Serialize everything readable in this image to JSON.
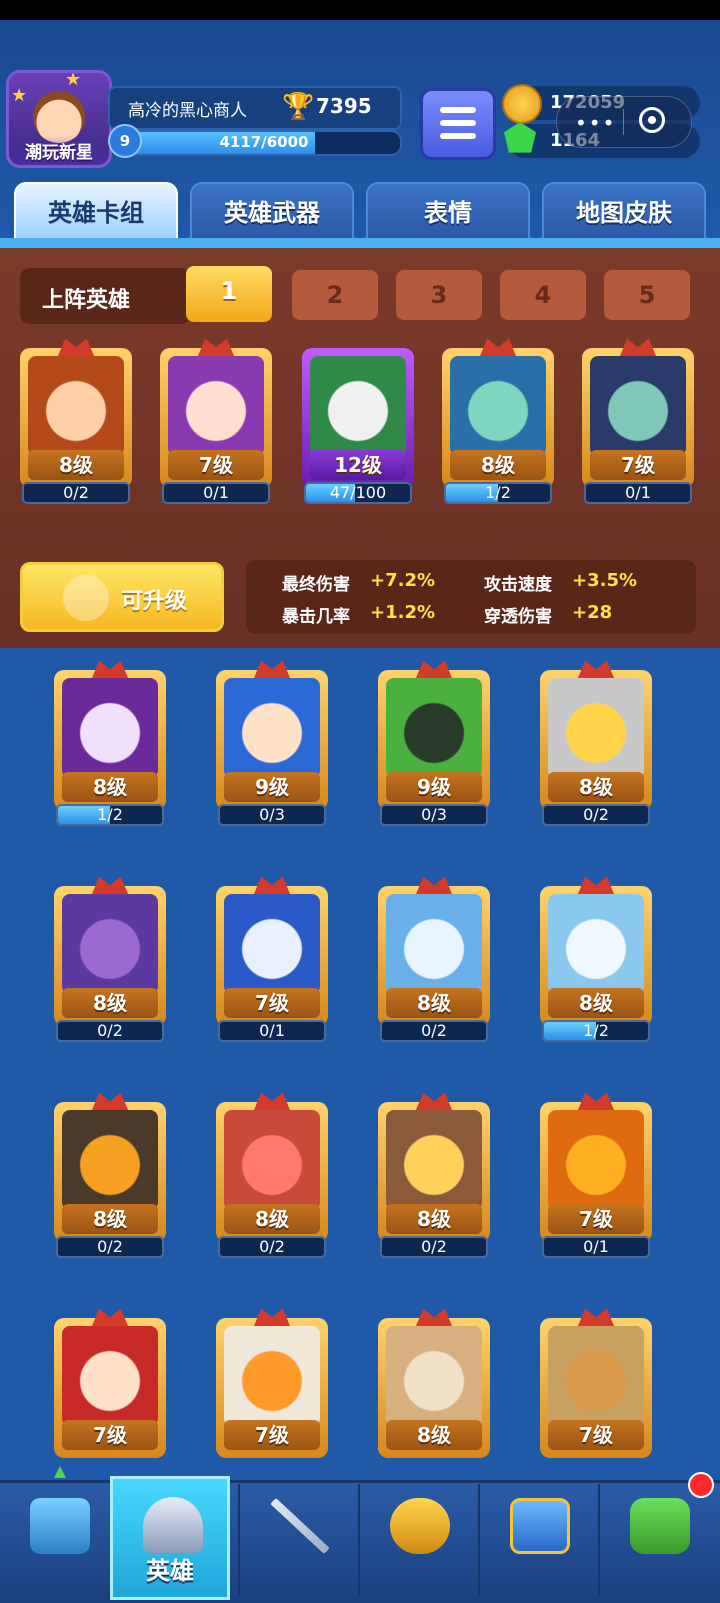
{
  "player": {
    "title": "潮玩新星",
    "name": "高冷的黑心商人",
    "trophies": "7395",
    "level": "9",
    "xp_text": "4117/6000",
    "xp_fraction": 0.686
  },
  "currency": {
    "coins": "172059",
    "gems": "1164"
  },
  "tabs": [
    {
      "label": "英雄卡组",
      "active": true
    },
    {
      "label": "英雄武器"
    },
    {
      "label": "表情"
    },
    {
      "label": "地图皮肤"
    }
  ],
  "lineup": {
    "label": "上阵英雄",
    "slots": [
      "1",
      "2",
      "3",
      "4",
      "5"
    ],
    "active_slot": "1",
    "heroes": [
      {
        "level": "8级",
        "progress": "0/2",
        "fill": 0
      },
      {
        "level": "7级",
        "progress": "0/1",
        "fill": 0
      },
      {
        "level": "12级",
        "progress": "47/100",
        "fill": 0.47
      },
      {
        "level": "8级",
        "progress": "1/2",
        "fill": 0.5
      },
      {
        "level": "7级",
        "progress": "0/1",
        "fill": 0
      }
    ]
  },
  "upgrade_button": "可升级",
  "stats": [
    {
      "label": "最终伤害",
      "value": "+7.2%"
    },
    {
      "label": "攻击速度",
      "value": "+3.5%"
    },
    {
      "label": "暴击几率",
      "value": "+1.2%"
    },
    {
      "label": "穿透伤害",
      "value": "+28"
    }
  ],
  "roster": [
    {
      "level": "8级",
      "progress": "1/2",
      "fill": 0.5
    },
    {
      "level": "9级",
      "progress": "0/3",
      "fill": 0
    },
    {
      "level": "9级",
      "progress": "0/3",
      "fill": 0
    },
    {
      "level": "8级",
      "progress": "0/2",
      "fill": 0
    },
    {
      "level": "8级",
      "progress": "0/2",
      "fill": 0
    },
    {
      "level": "7级",
      "progress": "0/1",
      "fill": 0
    },
    {
      "level": "8级",
      "progress": "0/2",
      "fill": 0
    },
    {
      "level": "8级",
      "progress": "1/2",
      "fill": 0.5
    },
    {
      "level": "8级",
      "progress": "0/2",
      "fill": 0
    },
    {
      "level": "8级",
      "progress": "0/2",
      "fill": 0
    },
    {
      "level": "8级",
      "progress": "0/2",
      "fill": 0
    },
    {
      "level": "7级",
      "progress": "0/1",
      "fill": 0
    },
    {
      "level": "7级",
      "progress": "",
      "fill": 0
    },
    {
      "level": "7级",
      "progress": "",
      "fill": 0
    },
    {
      "level": "8级",
      "progress": "",
      "fill": 0
    },
    {
      "level": "7级",
      "progress": "",
      "fill": 0
    }
  ],
  "nav": [
    {
      "icon": "treasure-chest-icon",
      "label": ""
    },
    {
      "icon": "knight-helmet-icon",
      "label": "英雄"
    },
    {
      "icon": "crossed-swords-icon",
      "label": ""
    },
    {
      "icon": "crown-shield-icon",
      "label": ""
    },
    {
      "icon": "team-banner-icon",
      "label": ""
    },
    {
      "icon": "sprout-island-icon",
      "label": ""
    }
  ],
  "colors": {
    "accent_gold": "#f5b821",
    "panel_brown": "#7a3a2a",
    "bg_blue": "#1f5aa8"
  }
}
